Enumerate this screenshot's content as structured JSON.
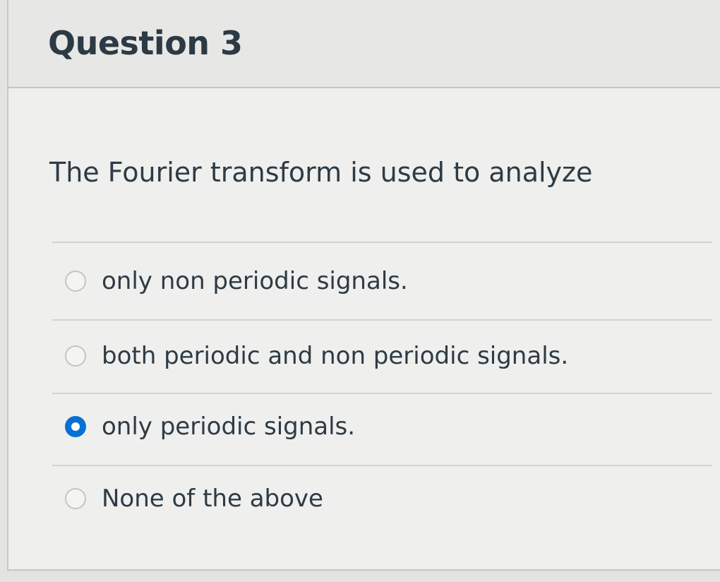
{
  "question": {
    "title": "Question 3",
    "text": "The Fourier transform is used to analyze",
    "answers": [
      {
        "label": "only non periodic signals.",
        "selected": false
      },
      {
        "label": "both periodic and non periodic signals.",
        "selected": false
      },
      {
        "label": "only periodic signals.",
        "selected": true
      },
      {
        "label": "None of the above",
        "selected": false
      }
    ]
  },
  "colors": {
    "selected_radio": "#0770d6",
    "text": "#2d3b45",
    "header_bg": "#e7e7e5"
  }
}
